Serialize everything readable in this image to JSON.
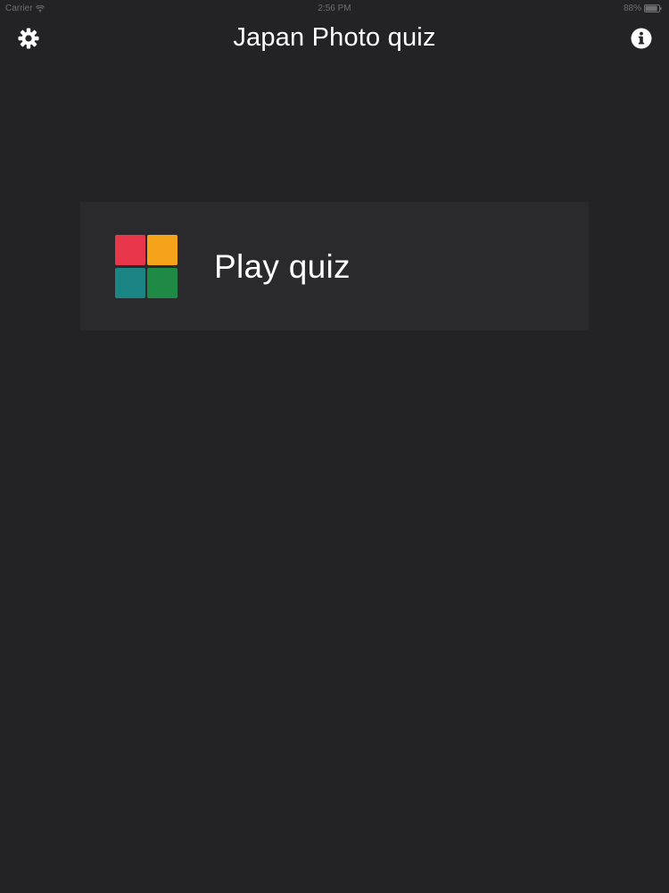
{
  "status_bar": {
    "carrier": "Carrier",
    "time": "2:56 PM",
    "battery_percent": "88%",
    "battery_level": 0.88,
    "icons": [
      "wifi-icon",
      "battery-icon"
    ]
  },
  "nav": {
    "title": "Japan Photo quiz",
    "left_icon": "gear-icon",
    "right_icon": "info-icon"
  },
  "play_card": {
    "label": "Play quiz",
    "icon": "quiz-grid-icon"
  },
  "colors": {
    "background": "#232225",
    "card": "#2a292c",
    "tile_red": "#e8374b",
    "tile_orange": "#f6a31c",
    "tile_teal": "#1b8586",
    "tile_green": "#1e8a45",
    "text": "#ffffff",
    "status_text": "#6e6d72"
  }
}
